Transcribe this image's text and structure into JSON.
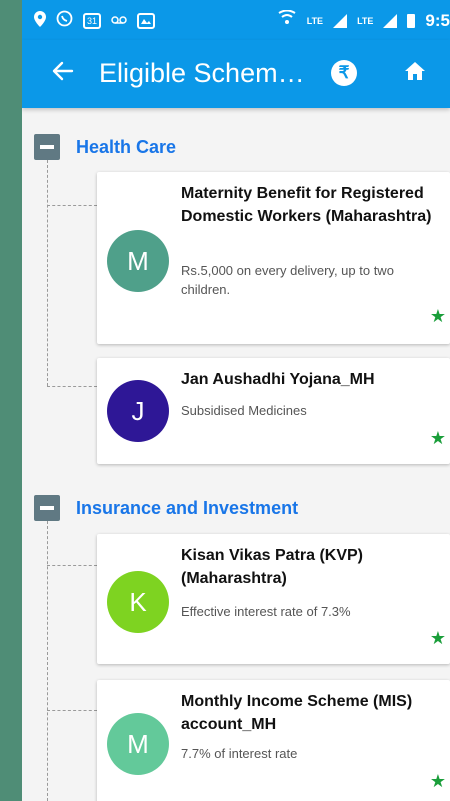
{
  "status_bar": {
    "time": "9:5",
    "lte_1": "LTE",
    "lte_2": "LTE",
    "calendar_day": "31"
  },
  "app_bar": {
    "title": "Eligible Schem…",
    "back_icon": "back-arrow-icon",
    "rupee_icon": "rupee-icon",
    "rupee_symbol": "₹",
    "home_icon": "home-icon"
  },
  "colors": {
    "primary": "#0b98e8",
    "category_text": "#1976e8",
    "star": "#1a9e3a"
  },
  "categories": [
    {
      "label": "Health Care",
      "schemes": [
        {
          "initial": "M",
          "avatar_color": "#4fa08a",
          "title": "Maternity Benefit for Registered Domestic Workers (Maharashtra)",
          "description": "Rs.5,000 on every delivery, up to two children."
        },
        {
          "initial": "J",
          "avatar_color": "#2e1796",
          "title": "Jan Aushadhi Yojana_MH",
          "description": "Subsidised Medicines"
        }
      ]
    },
    {
      "label": "Insurance and Investment",
      "schemes": [
        {
          "initial": "K",
          "avatar_color": "#7ed321",
          "title": "Kisan Vikas Patra (KVP) (Maharashtra)",
          "description": "Effective interest rate of 7.3%"
        },
        {
          "initial": "M",
          "avatar_color": "#63c99a",
          "title": "Monthly Income Scheme (MIS) account_MH",
          "description": "7.7% of interest rate"
        }
      ]
    }
  ],
  "star_symbol": "★"
}
